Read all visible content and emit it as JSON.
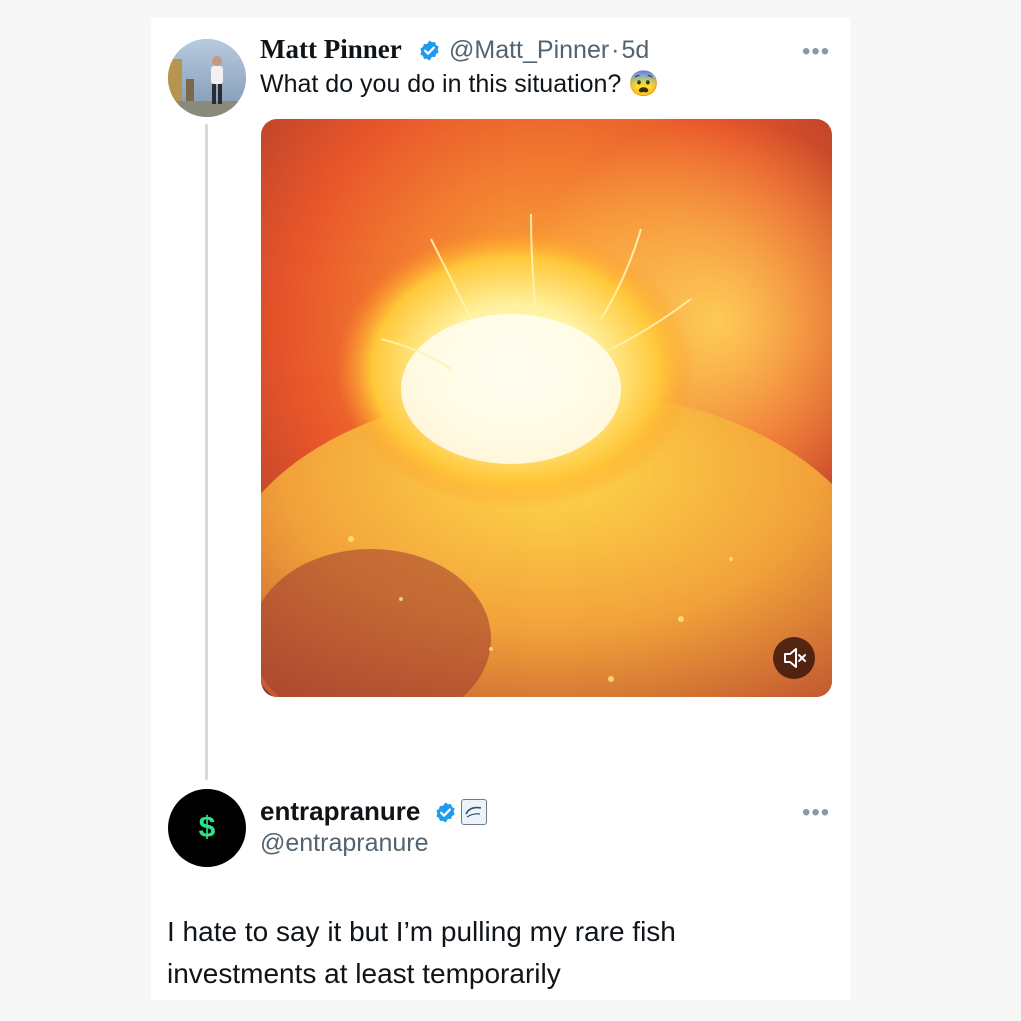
{
  "tweet1": {
    "name": "Matt Pinner",
    "handle": "@Matt_Pinner",
    "separator": "·",
    "time": "5d",
    "text": "What do you do in this situation? 😨",
    "more": "•••",
    "avatar_icon": "profile-photo-person",
    "media_icon": "video-lava-eruption",
    "mute_icon": "speaker-muted-icon"
  },
  "tweet2": {
    "name": "entrapranure",
    "handle": "@entrapranure",
    "more": "•••",
    "avatar_symbol": "$",
    "text": "I hate to say it but I’m pulling my rare fish investments at least temporarily"
  },
  "colors": {
    "verified_blue": "#1d9bf0",
    "handle_gray": "#536471",
    "thread_line": "#cfd9de",
    "dollar_green": "#2fe08a"
  }
}
